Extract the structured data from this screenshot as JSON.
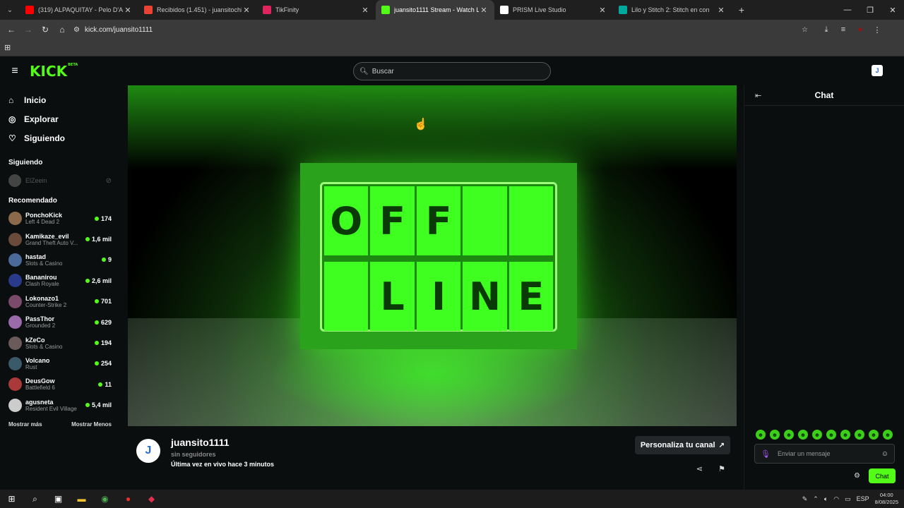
{
  "browser": {
    "tabs": [
      {
        "title": "(319) ALPAQUITAY - Pelo D'Ami",
        "favicon_color": "#ff0000",
        "icon": "youtube-icon",
        "active": false
      },
      {
        "title": "Recibidos (1.451) - juansitochip",
        "favicon_color": "#ea4335",
        "icon": "gmail-icon",
        "active": false
      },
      {
        "title": "TikFinity",
        "favicon_color": "#e0245e",
        "icon": "tikfinity-icon",
        "active": false
      },
      {
        "title": "juansito1111 Stream - Watch Li",
        "favicon_color": "#53fc18",
        "icon": "kick-icon",
        "active": true
      },
      {
        "title": "PRISM Live Studio",
        "favicon_color": "#ffffff",
        "icon": "prism-icon",
        "active": false
      },
      {
        "title": "Lilo y Stitch 2: Stitch en con",
        "favicon_color": "#00a99d",
        "icon": "stitch-icon",
        "active": false
      }
    ],
    "url": "kick.com/juansito1111"
  },
  "header": {
    "logo": "KICK",
    "logo_tag": "BETA",
    "search_placeholder": "Buscar"
  },
  "sidebar": {
    "nav": [
      {
        "label": "Inicio",
        "icon": "home-icon"
      },
      {
        "label": "Explorar",
        "icon": "compass-icon"
      },
      {
        "label": "Siguiendo",
        "icon": "heart-icon"
      }
    ],
    "following_title": "Siguiendo",
    "following": [
      {
        "name": "ElZeein"
      }
    ],
    "recommended_title": "Recomendado",
    "recommended": [
      {
        "name": "PonchoKick",
        "category": "Left 4 Dead 2",
        "viewers": "174",
        "color": "#8a6a4a"
      },
      {
        "name": "Kamikaze_evil",
        "category": "Grand Theft Auto V...",
        "viewers": "1,6 mil",
        "color": "#6a4a3a"
      },
      {
        "name": "hastad",
        "category": "Slots & Casino",
        "viewers": "9",
        "color": "#4a6a9a"
      },
      {
        "name": "Bananirou",
        "category": "Clash Royale",
        "viewers": "2,6 mil",
        "color": "#2a3a8a"
      },
      {
        "name": "Lokonazo1",
        "category": "Counter-Strike 2",
        "viewers": "701",
        "color": "#7a4a6a"
      },
      {
        "name": "PassThor",
        "category": "Grounded 2",
        "viewers": "629",
        "color": "#9a6aaa"
      },
      {
        "name": "kZeCo",
        "category": "Slots & Casino",
        "viewers": "194",
        "color": "#6a5a5a"
      },
      {
        "name": "Volcano",
        "category": "Rust",
        "viewers": "254",
        "color": "#3a5a6a"
      },
      {
        "name": "DeusGow",
        "category": "Battlefield 6",
        "viewers": "11",
        "color": "#aa3a3a"
      },
      {
        "name": "agusneta",
        "category": "Resident Evil Village",
        "viewers": "5,4 mil",
        "color": "#cccccc"
      }
    ],
    "show_more": "Mostrar más",
    "show_less": "Mostrar Menos"
  },
  "player": {
    "board_row1": [
      "O",
      "F",
      "F",
      "",
      ""
    ],
    "board_row2": [
      "",
      "L",
      "I",
      "N",
      "E"
    ]
  },
  "channel": {
    "name": "juansito1111",
    "followers": "sin seguidores",
    "last_live": "Última vez en vivo hace 3 minutos",
    "customize_label": "Personaliza tu canal"
  },
  "chat": {
    "title": "Chat",
    "placeholder": "Enviar un mensaje",
    "send_label": "Chat",
    "emote_count": 10
  },
  "taskbar": {
    "lang": "ESP",
    "time": "04:00",
    "date": "8/08/2025"
  },
  "colors": {
    "accent": "#53fc18",
    "background": "#0b0e0f"
  }
}
